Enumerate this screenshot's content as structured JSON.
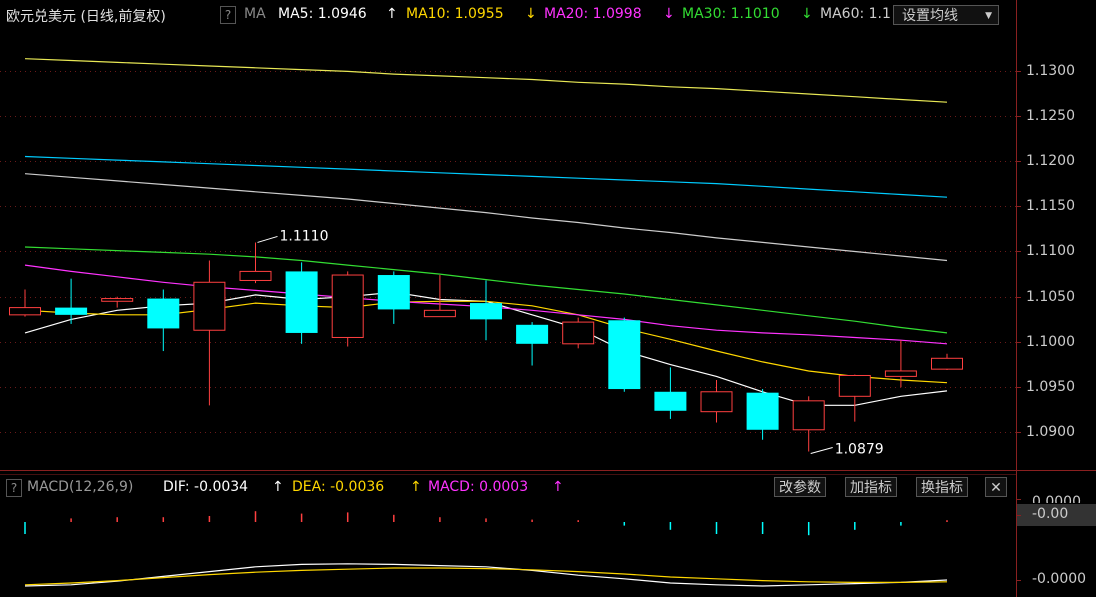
{
  "header": {
    "title": "欧元兑美元 (日线,前复权)",
    "help": "?",
    "ma_label": "MA",
    "ma5": {
      "label": "MA5: 1.0946",
      "arrow": "↑",
      "color": "#ffffff"
    },
    "ma10": {
      "label": "MA10: 1.0955",
      "arrow": "↓",
      "color": "#ffd700"
    },
    "ma20": {
      "label": "MA20: 1.0998",
      "arrow": "↓",
      "color": "#ff33ff"
    },
    "ma30": {
      "label": "MA30: 1.1010",
      "arrow": "↓",
      "color": "#33dd33"
    },
    "ma60": {
      "label": "MA60: 1.1",
      "color": "#cccccc"
    },
    "settings_button": "设置均线"
  },
  "macd_header": {
    "help": "?",
    "name": "MACD(12,26,9)",
    "dif": "DIF: -0.0034",
    "dif_arrow": "↑",
    "dea": "DEA: -0.0036",
    "dea_arrow": "↑",
    "macd": "MACD: 0.0003",
    "macd_arrow": "↑",
    "btn_params": "改参数",
    "btn_add": "加指标",
    "btn_switch": "换指标",
    "btn_close": "✕"
  },
  "colors": {
    "up": "#ff4040",
    "down": "#00ffff",
    "ma5": "#ffffff",
    "ma10": "#ffd700",
    "ma20": "#ff33ff",
    "ma30": "#33dd33",
    "ma60": "#cccccc",
    "ma120": "#00ccff",
    "ma250": "#e8e855"
  },
  "chart_data": {
    "type": "candlestick",
    "ylim": [
      1.087,
      1.133
    ],
    "y_ticks": [
      "1.1300",
      "1.1250",
      "1.1200",
      "1.1150",
      "1.1100",
      "1.1050",
      "1.1000",
      "1.0950",
      "1.0900"
    ],
    "annotations": {
      "high": "1.1110",
      "low": "1.0879"
    },
    "candles": [
      {
        "o": 1.103,
        "c": 1.1038,
        "h": 1.1058,
        "l": 1.1028
      },
      {
        "o": 1.1038,
        "c": 1.103,
        "h": 1.107,
        "l": 1.102
      },
      {
        "o": 1.1045,
        "c": 1.1048,
        "h": 1.105,
        "l": 1.1038
      },
      {
        "o": 1.1048,
        "c": 1.1015,
        "h": 1.1058,
        "l": 1.099
      },
      {
        "o": 1.1013,
        "c": 1.1066,
        "h": 1.109,
        "l": 1.093
      },
      {
        "o": 1.1068,
        "c": 1.1078,
        "h": 1.111,
        "l": 1.1065
      },
      {
        "o": 1.1078,
        "c": 1.101,
        "h": 1.1088,
        "l": 1.0998
      },
      {
        "o": 1.1005,
        "c": 1.1074,
        "h": 1.1078,
        "l": 1.0995
      },
      {
        "o": 1.1074,
        "c": 1.1036,
        "h": 1.1078,
        "l": 1.102
      },
      {
        "o": 1.1028,
        "c": 1.1035,
        "h": 1.1074,
        "l": 1.1028
      },
      {
        "o": 1.1043,
        "c": 1.1025,
        "h": 1.1068,
        "l": 1.1002
      },
      {
        "o": 1.1019,
        "c": 1.0998,
        "h": 1.1022,
        "l": 1.0974
      },
      {
        "o": 1.0998,
        "c": 1.1022,
        "h": 1.1027,
        "l": 1.0993
      },
      {
        "o": 1.1024,
        "c": 1.0948,
        "h": 1.1027,
        "l": 1.0945
      },
      {
        "o": 1.0945,
        "c": 1.0924,
        "h": 1.0972,
        "l": 1.0915
      },
      {
        "o": 1.0923,
        "c": 1.0945,
        "h": 1.0958,
        "l": 1.0911
      },
      {
        "o": 1.0944,
        "c": 1.0903,
        "h": 1.0948,
        "l": 1.0892
      },
      {
        "o": 1.0903,
        "c": 1.0935,
        "h": 1.094,
        "l": 1.0879
      },
      {
        "o": 1.094,
        "c": 1.0963,
        "h": 1.0964,
        "l": 1.0912
      },
      {
        "o": 1.0962,
        "c": 1.0968,
        "h": 1.1002,
        "l": 1.095
      },
      {
        "o": 1.097,
        "c": 1.0982,
        "h": 1.0987,
        "l": 1.0969
      }
    ],
    "ma_series": [
      {
        "name": "MA5",
        "color_key": "ma5",
        "values": [
          1.101,
          1.1025,
          1.1035,
          1.104,
          1.1043,
          1.1052,
          1.1047,
          1.105,
          1.1055,
          1.1047,
          1.1045,
          1.103,
          1.1015,
          1.099,
          1.0975,
          1.0962,
          1.0945,
          1.093,
          1.093,
          1.094,
          1.0946
        ]
      },
      {
        "name": "MA10",
        "color_key": "ma10",
        "values": [
          1.1035,
          1.1032,
          1.103,
          1.103,
          1.1036,
          1.1043,
          1.104,
          1.1038,
          1.1044,
          1.1045,
          1.1045,
          1.104,
          1.103,
          1.1015,
          1.1003,
          1.099,
          1.0978,
          1.0968,
          1.0962,
          1.0958,
          1.0955
        ]
      },
      {
        "name": "MA20",
        "color_key": "ma20",
        "values": [
          1.1085,
          1.1078,
          1.1072,
          1.1066,
          1.1061,
          1.1057,
          1.1053,
          1.1049,
          1.1045,
          1.1042,
          1.1039,
          1.1035,
          1.103,
          1.1025,
          1.1018,
          1.1013,
          1.101,
          1.1008,
          1.1005,
          1.1002,
          1.0998
        ]
      },
      {
        "name": "MA30",
        "color_key": "ma30",
        "values": [
          1.1105,
          1.1103,
          1.1101,
          1.1099,
          1.1097,
          1.1094,
          1.109,
          1.1085,
          1.108,
          1.1075,
          1.1069,
          1.1063,
          1.1058,
          1.1053,
          1.1047,
          1.1041,
          1.1035,
          1.1029,
          1.1023,
          1.1016,
          1.101
        ]
      },
      {
        "name": "MA60",
        "color_key": "ma60",
        "values": [
          1.1186,
          1.1182,
          1.1178,
          1.1174,
          1.117,
          1.1166,
          1.1162,
          1.1158,
          1.1153,
          1.1148,
          1.1143,
          1.1137,
          1.1132,
          1.1126,
          1.1121,
          1.1115,
          1.111,
          1.1105,
          1.11,
          1.1095,
          1.109
        ]
      },
      {
        "name": "MA120",
        "color_key": "ma120",
        "values": [
          1.1205,
          1.1203,
          1.1201,
          1.1199,
          1.1197,
          1.1195,
          1.1193,
          1.1191,
          1.1189,
          1.1187,
          1.1185,
          1.1183,
          1.1181,
          1.1179,
          1.1177,
          1.1175,
          1.1172,
          1.1169,
          1.1166,
          1.1163,
          1.116
        ]
      },
      {
        "name": "MA250",
        "color_key": "ma250",
        "values": [
          1.1313,
          1.1311,
          1.1309,
          1.1307,
          1.1305,
          1.1303,
          1.1301,
          1.1299,
          1.1296,
          1.1294,
          1.1292,
          1.129,
          1.1287,
          1.1285,
          1.1282,
          1.128,
          1.1277,
          1.1274,
          1.1271,
          1.1268,
          1.1265
        ]
      }
    ],
    "macd": {
      "ylim": [
        -0.0012,
        0.0003
      ],
      "y_ticks": [
        "0.0000",
        "-0.00",
        "-0.0000"
      ],
      "hist": [
        -0.0002,
        6e-05,
        8e-05,
        8e-05,
        0.0001,
        0.00018,
        0.00014,
        0.00016,
        0.00012,
        8e-05,
        6e-05,
        4e-05,
        3e-05,
        -6e-05,
        -0.00013,
        -0.0002,
        -0.0002,
        -0.00022,
        -0.00013,
        -6e-05,
        3e-05
      ],
      "dif": [
        -0.0012,
        -0.00118,
        -0.00112,
        -0.00104,
        -0.00096,
        -0.00088,
        -0.00084,
        -0.00083,
        -0.00084,
        -0.00086,
        -0.00088,
        -0.00094,
        -0.00102,
        -0.00108,
        -0.00115,
        -0.00118,
        -0.0012,
        -0.00118,
        -0.00116,
        -0.00114,
        -0.0011
      ],
      "dea": [
        -0.00118,
        -0.00115,
        -0.00111,
        -0.00106,
        -0.00101,
        -0.00097,
        -0.00094,
        -0.00092,
        -0.0009,
        -0.0009,
        -0.00091,
        -0.00093,
        -0.00096,
        -0.001,
        -0.00105,
        -0.00108,
        -0.00111,
        -0.00113,
        -0.00114,
        -0.00114,
        -0.00113
      ]
    }
  }
}
